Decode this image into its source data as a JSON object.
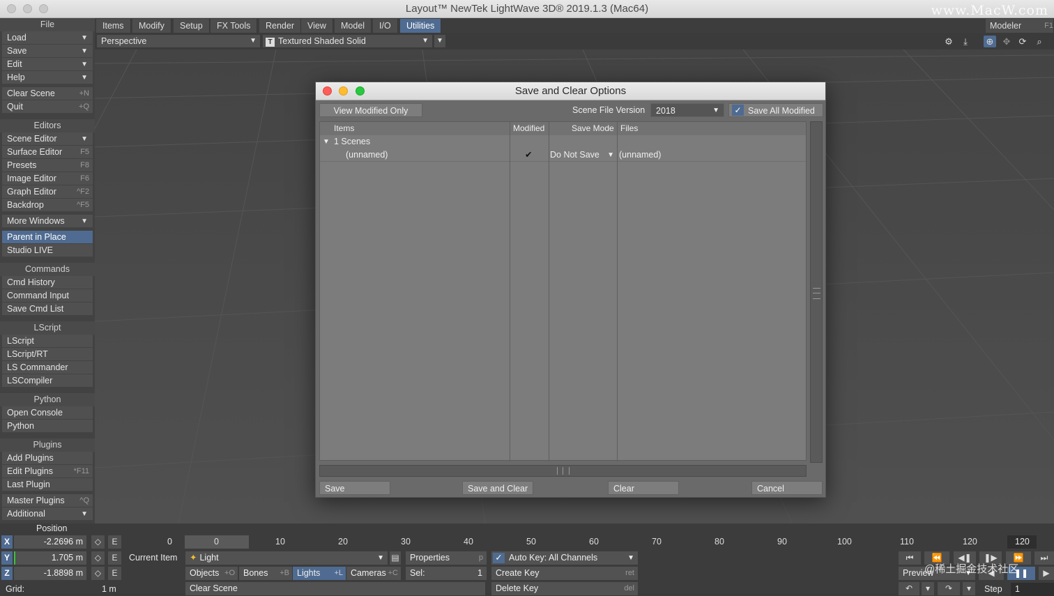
{
  "window": {
    "title": "Layout™ NewTek LightWave 3D® 2019.1.3 (Mac64)",
    "watermark": "www.MacW.com"
  },
  "sidebar": {
    "file_header": "File",
    "file_items": [
      {
        "label": "Load"
      },
      {
        "label": "Save"
      },
      {
        "label": "Edit"
      },
      {
        "label": "Help"
      }
    ],
    "clear_scene": {
      "label": "Clear Scene",
      "key": "+N"
    },
    "quit": {
      "label": "Quit",
      "key": "+Q"
    },
    "editors_header": "Editors",
    "scene_editor": "Scene Editor",
    "editors": [
      {
        "label": "Surface Editor",
        "key": "F5"
      },
      {
        "label": "Presets",
        "key": "F8"
      },
      {
        "label": "Image Editor",
        "key": "F6"
      },
      {
        "label": "Graph Editor",
        "key": "^F2"
      },
      {
        "label": "Backdrop",
        "key": "^F5"
      }
    ],
    "more_windows": "More Windows",
    "parent_in_place": "Parent in Place",
    "studio_live": "Studio LIVE",
    "commands_header": "Commands",
    "commands": [
      {
        "label": "Cmd History"
      },
      {
        "label": "Command Input"
      },
      {
        "label": "Save Cmd List"
      }
    ],
    "lscript_header": "LScript",
    "lscript": [
      {
        "label": "LScript"
      },
      {
        "label": "LScript/RT"
      },
      {
        "label": "LS Commander"
      },
      {
        "label": "LSCompiler"
      }
    ],
    "python_header": "Python",
    "python": [
      {
        "label": "Open Console"
      },
      {
        "label": "Python"
      }
    ],
    "plugins_header": "Plugins",
    "plugins": [
      {
        "label": "Add Plugins",
        "key": ""
      },
      {
        "label": "Edit Plugins",
        "key": "*F11"
      },
      {
        "label": "Last Plugin",
        "key": ""
      }
    ],
    "master_plugins": {
      "label": "Master Plugins",
      "key": "^Q"
    },
    "additional": "Additional"
  },
  "menubar": {
    "tabs": [
      "Items",
      "Modify",
      "Setup",
      "FX Tools",
      "Render",
      "View",
      "Model",
      "I/O",
      "Utilities"
    ],
    "modeler": "Modeler",
    "modeler_key": "F1"
  },
  "toolbar": {
    "view": "Perspective",
    "shading": "Textured Shaded Solid",
    "shading_icon": "T"
  },
  "dialog": {
    "title": "Save and Clear Options",
    "view_modified_only": "View Modified Only",
    "scene_file_version_label": "Scene File Version",
    "scene_file_version": "2018",
    "save_all_modified": "Save All Modified",
    "columns": [
      "Items",
      "Modified",
      "Save Mode",
      "Files"
    ],
    "group": "1 Scenes",
    "rows": [
      {
        "item": "(unnamed)",
        "modified": "✔",
        "save_mode": "Do Not Save",
        "file": "(unnamed)"
      }
    ],
    "buttons": {
      "save": "Save",
      "save_and_clear": "Save and Clear",
      "clear": "Clear",
      "cancel": "Cancel"
    }
  },
  "bottom": {
    "position_label": "Position",
    "x_label": "X",
    "x_value": "-2.2696 m",
    "y_label": "Y",
    "y_value": "1.705 m",
    "z_label": "Z",
    "z_value": "-1.8898 m",
    "e_label": "E",
    "grid_label": "Grid:",
    "grid_value": "1 m",
    "frame_start": "0",
    "ticks": [
      "0",
      "10",
      "20",
      "30",
      "40",
      "50",
      "60",
      "70",
      "80",
      "90",
      "100",
      "110",
      "120"
    ],
    "frame_end": "120",
    "current_item_label": "Current Item",
    "current_item": "Light",
    "properties": "Properties",
    "properties_key": "p",
    "auto_key": "Auto Key: All Channels",
    "objects": "Objects",
    "objects_key": "+O",
    "bones": "Bones",
    "bones_key": "+B",
    "lights": "Lights",
    "lights_key": "+L",
    "cameras": "Cameras",
    "cameras_key": "+C",
    "sel_label": "Sel:",
    "sel_value": "1",
    "create_key": "Create Key",
    "create_key_hotkey": "ret",
    "delete_key": "Delete Key",
    "delete_key_hotkey": "del",
    "clear_scene": "Clear Scene",
    "preview": "Preview",
    "step_label": "Step",
    "step_value": "1",
    "watermark": "@稀土掘金技术社区"
  }
}
